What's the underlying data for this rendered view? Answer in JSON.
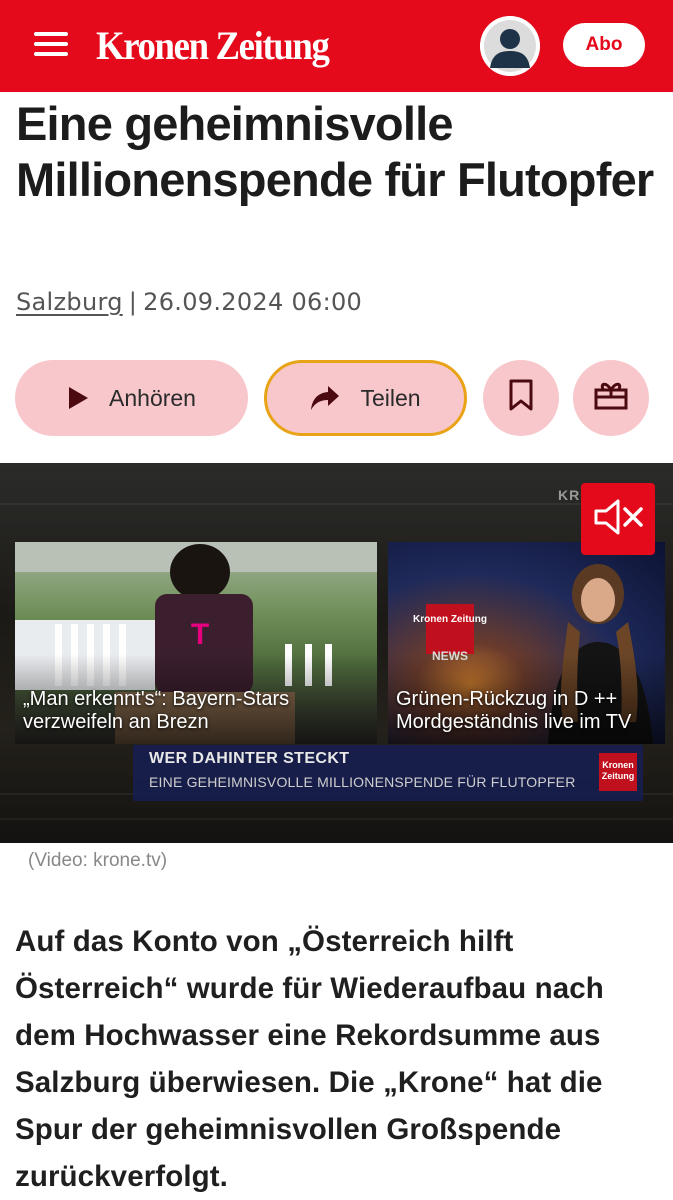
{
  "header": {
    "logo": "Kronen Zeitung",
    "abo_label": "Abo",
    "menu_icon": "hamburger-menu-icon",
    "profile_icon": "user-avatar-icon",
    "brand_color": "#e4091b"
  },
  "article": {
    "headline": "Eine geheimnisvolle Millionenspende für Flutopfer",
    "location": "Salzburg",
    "separator": "|",
    "datetime": "26.09.2024 06:00",
    "actions": {
      "listen_label": "Anhören",
      "share_label": "Teilen",
      "bookmark_icon": "bookmark-icon",
      "gift_icon": "gift-icon"
    },
    "video": {
      "channel_bug": "KRONE TV",
      "mute_icon": "speaker-muted-icon",
      "tiles": [
        {
          "caption": "„Man erkennt's“: Bayern-Stars verzweifeln an Brezn"
        },
        {
          "caption": "Grünen-Rückzug in D ++ Mordgeständnis live im TV",
          "badge_top": "Kronen Zeitung",
          "badge_bottom": "NEWS"
        }
      ],
      "lower_third": {
        "line1": "WER DAHINTER STECKT",
        "line2": "EINE GEHEIMNISVOLLE MILLIONENSPENDE FÜR FLUTOPFER",
        "logo": "Kronen Zeitung"
      },
      "credit": "(Video: krone.tv)"
    },
    "lead": "Auf das Konto von „Österreich hilft Österreich“ wurde für Wiederaufbau nach dem Hochwasser eine Rekordsumme aus Salzburg überwiesen. Die „Krone“ hat die Spur der geheimnisvollen Großspende zurückverfolgt."
  }
}
